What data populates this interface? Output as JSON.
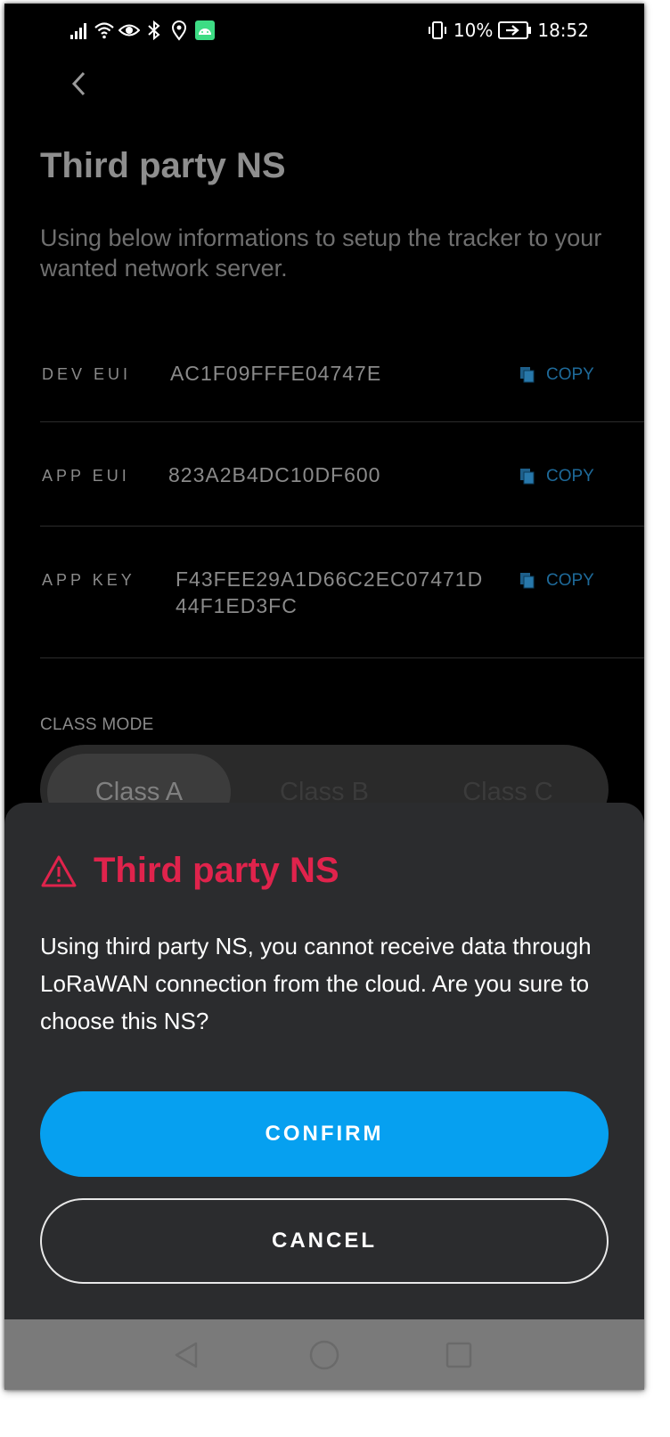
{
  "status_bar": {
    "battery_percent": "10%",
    "time": "18:52",
    "icons": [
      "signal-icon",
      "wifi-icon",
      "eye-icon",
      "bluetooth-icon",
      "location-icon",
      "android-icon",
      "vibrate-icon",
      "battery-charging-icon"
    ]
  },
  "page": {
    "title": "Third party NS",
    "description": "Using below informations to setup the tracker to your wanted network server.",
    "credentials": [
      {
        "label": "DEV EUI",
        "value": "AC1F09FFFE04747E",
        "copy_label": "COPY"
      },
      {
        "label": "APP EUI",
        "value": "823A2B4DC10DF600",
        "copy_label": "COPY"
      },
      {
        "label": "APP KEY",
        "value": "F43FEE29A1D66C2EC07471D44F1ED3FC",
        "copy_label": "COPY"
      }
    ],
    "class_mode": {
      "label": "CLASS MODE",
      "options": [
        "Class A",
        "Class B",
        "Class C"
      ],
      "selected": "Class A"
    }
  },
  "dialog": {
    "title": "Third party NS",
    "message": "Using third party NS, you cannot receive data through LoRaWAN connection from the cloud. Are you sure to choose this NS?",
    "confirm_label": "CONFIRM",
    "cancel_label": "CANCEL"
  },
  "colors": {
    "accent": "#06a0f0",
    "warning": "#e0234c",
    "sheet_bg": "#2b2c2e",
    "link": "#1e6a9a"
  }
}
